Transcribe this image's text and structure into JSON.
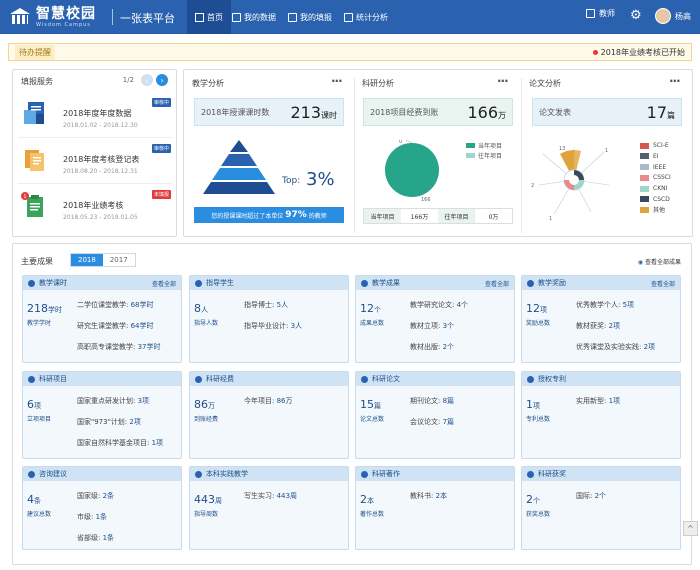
{
  "nav": {
    "logo_cn": "智慧校园",
    "logo_en": "Wisdom Campus",
    "platform": "一张表平台",
    "items": [
      "首页",
      "我的数据",
      "我的填报",
      "统计分析"
    ],
    "user_role": "教师",
    "user_name": "杨高"
  },
  "notice": {
    "label": "待办提醒",
    "message": "2018年业绩考核已开始"
  },
  "fill": {
    "title": "填报服务",
    "page": "1/2",
    "items": [
      {
        "title": "2018年度年度数据",
        "date": "2018.01.02 - 2018.12.30",
        "tag": "审核中",
        "tag_color": "#2a62b0"
      },
      {
        "title": "2018年度考核登记表",
        "date": "2018.08.20 - 2018.12.31",
        "tag": "审核中",
        "tag_color": "#2a62b0"
      },
      {
        "title": "2018年业绩考核",
        "date": "2018.05.23 - 2019.01.05",
        "tag": "未填报",
        "tag_color": "#e33b3b",
        "badge": "1"
      }
    ]
  },
  "teaching": {
    "title": "教学分析",
    "box_label": "2018年授课课时数",
    "box_value": "213",
    "box_unit": "课时",
    "top_label": "Top:",
    "top_value": "3%",
    "banner": "您的授课课时超过了本单位",
    "banner_pct": "97%",
    "banner_tail": "的教师"
  },
  "research": {
    "title": "科研分析",
    "box_label": "2018项目经费到账",
    "box_value": "166",
    "box_unit": "万",
    "legend": [
      "当年项目",
      "往年项目"
    ],
    "pie_zero": "0",
    "pie_value": "166",
    "cur_label": "当年项目",
    "cur_value": "166万",
    "prev_label": "往年项目",
    "prev_value": "0万"
  },
  "paper": {
    "title": "论文分析",
    "box_label": "论文发表",
    "box_value": "17",
    "box_unit": "篇",
    "legend": [
      "SCI-E",
      "EI",
      "IEEE",
      "CSSCI",
      "CKNI",
      "CSCD",
      "其他"
    ],
    "legend_colors": [
      "#d9534f",
      "#555f6e",
      "#a9b9c9",
      "#e88a8a",
      "#9dd6c8",
      "#3a4a5e",
      "#e0a33c"
    ],
    "radial_labels": [
      "13",
      "1",
      "2",
      "1"
    ]
  },
  "achievements": {
    "title": "主要成果",
    "years": [
      "2018",
      "2017"
    ],
    "view_all": "查看全部成果"
  },
  "cards": [
    {
      "title": "教学课时",
      "more": "查看全部",
      "value": "218",
      "unit": "学时",
      "label": "教学学时",
      "lines": [
        [
          "二学位课堂教学:",
          "68学时"
        ],
        [
          "研究生课堂教学:",
          "64学时"
        ],
        [
          "高职高专课堂教学:",
          "37学时"
        ]
      ]
    },
    {
      "title": "指导学生",
      "more": "",
      "value": "8",
      "unit": "人",
      "label": "指导人数",
      "lines": [
        [
          "指导博士:",
          "5人"
        ],
        [
          "指导毕业设计:",
          "3人"
        ]
      ]
    },
    {
      "title": "教学成果",
      "more": "查看全部",
      "value": "12",
      "unit": "个",
      "label": "成果总数",
      "lines": [
        [
          "教学研究论文:",
          "4个"
        ],
        [
          "教材立项:",
          "3个"
        ],
        [
          "教材出版:",
          "2个"
        ]
      ]
    },
    {
      "title": "教学奖励",
      "more": "查看全部",
      "value": "12",
      "unit": "项",
      "label": "奖励总数",
      "lines": [
        [
          "优秀教学个人:",
          "5项"
        ],
        [
          "教材获奖:",
          "2项"
        ],
        [
          "优秀课堂及实验实践:",
          "2项"
        ]
      ]
    },
    {
      "title": "科研项目",
      "more": "",
      "value": "6",
      "unit": "项",
      "label": "立项项目",
      "lines": [
        [
          "国家重点研发计划:",
          "3项"
        ],
        [
          "国家\"973\"计划:",
          "2项"
        ],
        [
          "国家自然科学基金项目:",
          "1项"
        ]
      ]
    },
    {
      "title": "科研经费",
      "more": "",
      "value": "86",
      "unit": "万",
      "label": "到账经费",
      "lines": [
        [
          "今年项目:",
          "86万"
        ]
      ]
    },
    {
      "title": "科研论文",
      "more": "",
      "value": "15",
      "unit": "篇",
      "label": "论文总数",
      "lines": [
        [
          "期刊论文:",
          "8篇"
        ],
        [
          "会议论文:",
          "7篇"
        ]
      ]
    },
    {
      "title": "授权专利",
      "more": "",
      "value": "1",
      "unit": "项",
      "label": "专利总数",
      "lines": [
        [
          "实用新型:",
          "1项"
        ]
      ]
    },
    {
      "title": "咨询建议",
      "more": "",
      "value": "4",
      "unit": "条",
      "label": "建议总数",
      "lines": [
        [
          "国家级:",
          "2条"
        ],
        [
          "市级:",
          "1条"
        ],
        [
          "省部级:",
          "1条"
        ]
      ]
    },
    {
      "title": "本科实践教学",
      "more": "",
      "value": "443",
      "unit": "周",
      "label": "指导周数",
      "lines": [
        [
          "写生实习:",
          "443周"
        ]
      ]
    },
    {
      "title": "科研著作",
      "more": "",
      "value": "2",
      "unit": "本",
      "label": "著作总数",
      "lines": [
        [
          "教科书:",
          "2本"
        ]
      ]
    },
    {
      "title": "科研获奖",
      "more": "",
      "value": "2",
      "unit": "个",
      "label": "获奖总数",
      "lines": [
        [
          "国际:",
          "2个"
        ]
      ]
    }
  ]
}
